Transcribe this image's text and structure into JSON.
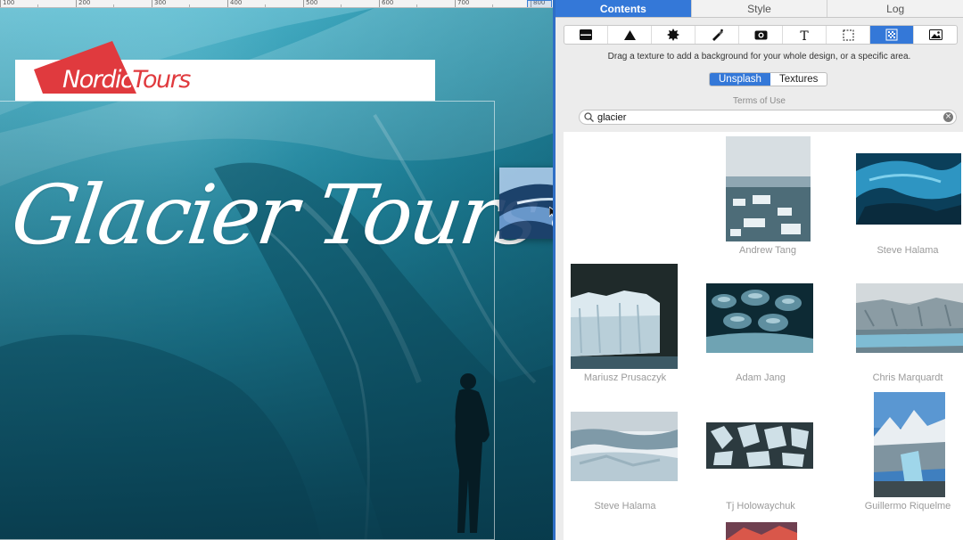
{
  "ruler": {
    "labels": [
      "100",
      "200",
      "300",
      "400",
      "500",
      "600",
      "700",
      "800"
    ]
  },
  "canvas": {
    "logo": {
      "word1": "Nordic",
      "word2": "Tours"
    },
    "hero_title": "Glacier Tours"
  },
  "panel": {
    "tabs": [
      {
        "label": "Contents",
        "active": true
      },
      {
        "label": "Style",
        "active": false
      },
      {
        "label": "Log",
        "active": false
      }
    ],
    "tools": [
      "layout-icon",
      "shape-icon",
      "badge-icon",
      "pen-icon",
      "image-icon",
      "text-icon",
      "area-icon",
      "texture-icon",
      "photo-icon"
    ],
    "active_tool": "texture-icon",
    "hint": "Drag a texture to add a background for your whole design, or a specific area.",
    "sources": {
      "unsplash": "Unsplash",
      "textures": "Textures",
      "active": "Unsplash"
    },
    "terms": "Terms of Use",
    "search": {
      "value": "glacier",
      "placeholder": "Search"
    },
    "results": [
      {
        "credit": ""
      },
      {
        "credit": "Andrew Tang"
      },
      {
        "credit": "Steve Halama"
      },
      {
        "credit": "Mariusz Prusaczyk"
      },
      {
        "credit": "Adam Jang"
      },
      {
        "credit": "Chris Marquardt"
      },
      {
        "credit": "Steve Halama"
      },
      {
        "credit": "Tj Holowaychuk"
      },
      {
        "credit": "Guillermo Riquelme"
      }
    ]
  },
  "colors": {
    "accent": "#3478d8",
    "logo_red": "#e03a3e",
    "ice": "#1b7f98",
    "add_badge": "#2f9a2a"
  }
}
